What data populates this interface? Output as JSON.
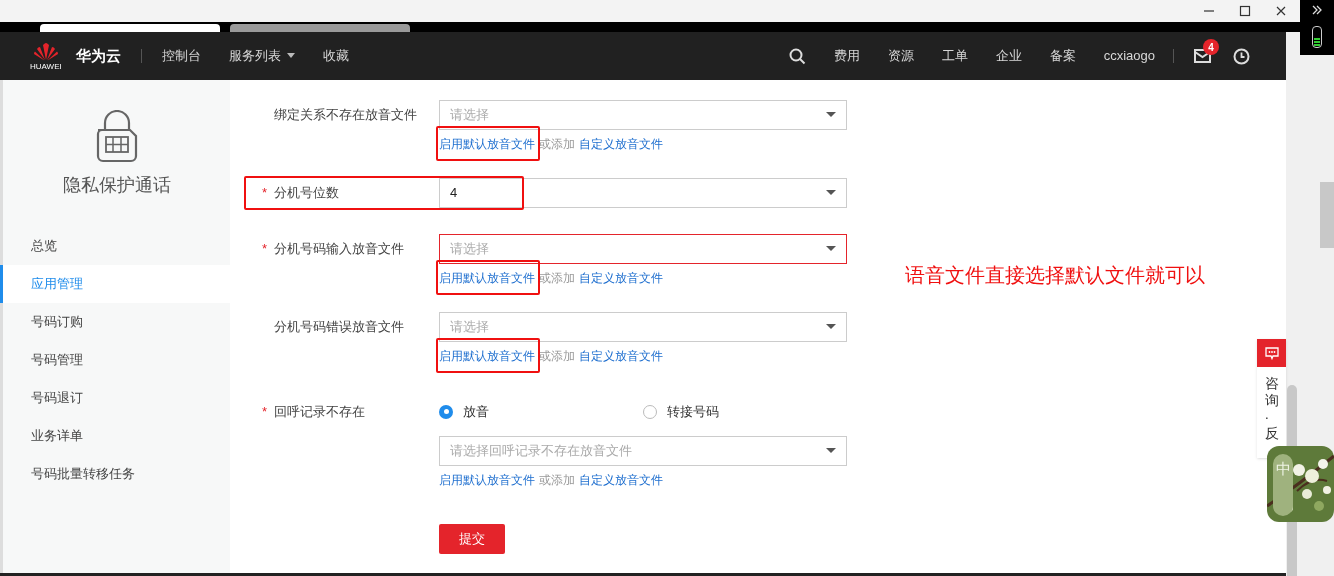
{
  "nav": {
    "logo_caption": "HUAWEI",
    "brand": "华为云",
    "left_links": [
      {
        "label": "控制台",
        "dropdown": false
      },
      {
        "label": "服务列表",
        "dropdown": true
      },
      {
        "label": "收藏",
        "dropdown": false
      }
    ],
    "right_links": [
      "费用",
      "资源",
      "工单",
      "企业",
      "备案",
      "ccxiaogo"
    ],
    "message_badge": "4"
  },
  "sidebar": {
    "title": "隐私保护通话",
    "items": [
      {
        "label": "总览",
        "selected": false
      },
      {
        "label": "应用管理",
        "selected": true
      },
      {
        "label": "号码订购",
        "selected": false
      },
      {
        "label": "号码管理",
        "selected": false
      },
      {
        "label": "号码退订",
        "selected": false
      },
      {
        "label": "业务详单",
        "selected": false
      },
      {
        "label": "号码批量转移任务",
        "selected": false
      }
    ]
  },
  "form": {
    "rows": [
      {
        "kind": "select",
        "label": "绑定关系不存在放音文件",
        "placeholder": "请选择",
        "error": false,
        "links": [
          "启用默认放音文件",
          "或添加",
          "自定义放音文件"
        ],
        "link_highlighted": true
      },
      {
        "kind": "select",
        "label": "分机号位数",
        "required_mark": "*",
        "value": "4",
        "error": false,
        "row_highlighted": true
      },
      {
        "kind": "select",
        "label": "分机号码输入放音文件",
        "required_mark": "*",
        "placeholder": "请选择",
        "error": true,
        "links": [
          "启用默认放音文件",
          "或添加",
          "自定义放音文件"
        ],
        "link_highlighted": true
      },
      {
        "kind": "select",
        "label": "分机号码错误放音文件",
        "placeholder": "请选择",
        "error": false,
        "links": [
          "启用默认放音文件",
          "或添加",
          "自定义放音文件"
        ],
        "link_highlighted": true
      },
      {
        "kind": "radio",
        "label": "回呼记录不存在",
        "required_mark": "*",
        "options": [
          {
            "label": "放音",
            "selected": true
          },
          {
            "label": "转接号码",
            "selected": false
          }
        ],
        "placeholder": "请选择回呼记录不存在放音文件",
        "links": [
          "启用默认放音文件",
          "或添加",
          "自定义放音文件"
        ]
      }
    ],
    "submit": "提交"
  },
  "annotation": "语音文件直接选择默认文件就可以",
  "float_panel": {
    "label": "咨询·反"
  },
  "ime_widget": {
    "label": "中"
  }
}
